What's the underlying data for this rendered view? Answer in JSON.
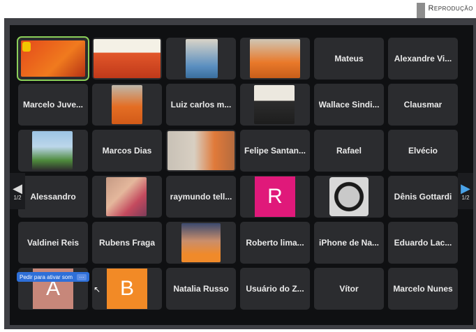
{
  "credit": "Reprodução",
  "pager": {
    "prev_label": "1/2",
    "next_label": "1/2"
  },
  "unmute_prompt": {
    "label": "Pedir para ativar som",
    "more": "···"
  },
  "letters": {
    "R": "R",
    "A": "A",
    "B": "B"
  },
  "colors": {
    "active_border": "#8bd05a",
    "R_tile": "#e0197a",
    "A_tile": "#c7877a",
    "B_tile": "#f28a26"
  },
  "names": {
    "r1c5": "Mateus",
    "r1c6": "Alexandre Vi...",
    "r2c1": "Marcelo Juve...",
    "r2c3": "Luiz carlos m...",
    "r2c5": "Wallace Sindi...",
    "r2c6": "Clausmar",
    "r3c2": "Marcos Dias",
    "r3c4": "Felipe Santan...",
    "r3c5": "Rafael",
    "r3c6": "Elvécio",
    "r4c1": "Alessandro",
    "r4c3": "raymundo tell...",
    "r4c6": "Dênis Gottardi",
    "r5c1": "Valdinei Reis",
    "r5c2": "Rubens Fraga",
    "r5c4": "Roberto lima...",
    "r5c5": "iPhone de Na...",
    "r5c6": "Eduardo Lac...",
    "r6c3": "Natalia Russo",
    "r6c4": "Usuário do Z...",
    "r6c5": "Vítor",
    "r6c6": "Marcelo Nunes"
  }
}
